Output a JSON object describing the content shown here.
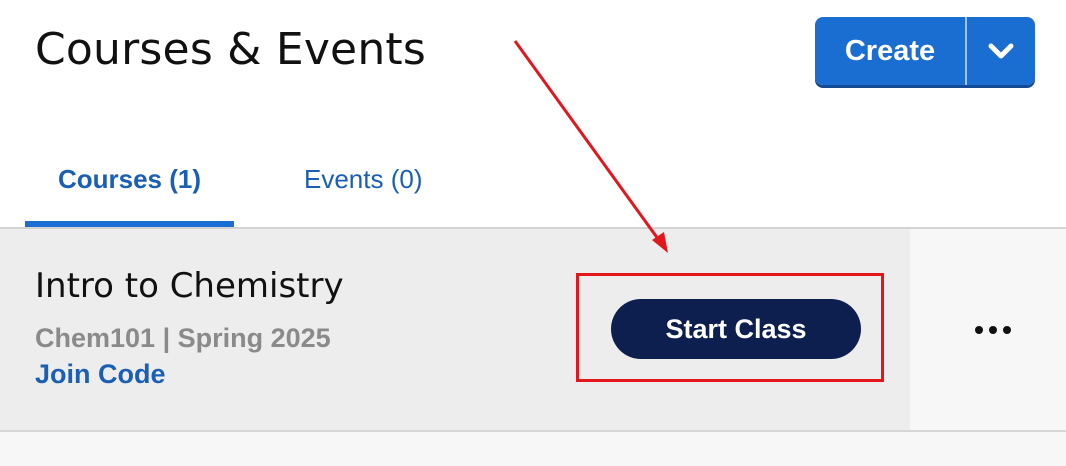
{
  "header": {
    "title": "Courses & Events",
    "create_label": "Create",
    "create_dropdown_icon": "chevron-down-icon"
  },
  "tabs": [
    {
      "label": "Courses (1)",
      "active": true
    },
    {
      "label": "Events (0)",
      "active": false
    }
  ],
  "course": {
    "name": "Intro to Chemistry",
    "meta": "Chem101 | Spring 2025",
    "join_code_label": "Join Code",
    "start_label": "Start Class",
    "more_icon": "more-horizontal-icon"
  },
  "colors": {
    "primary": "#1a6ed1",
    "start_button": "#0c1f4f",
    "annotation": "#e3161b",
    "link": "#1a5fb4"
  }
}
